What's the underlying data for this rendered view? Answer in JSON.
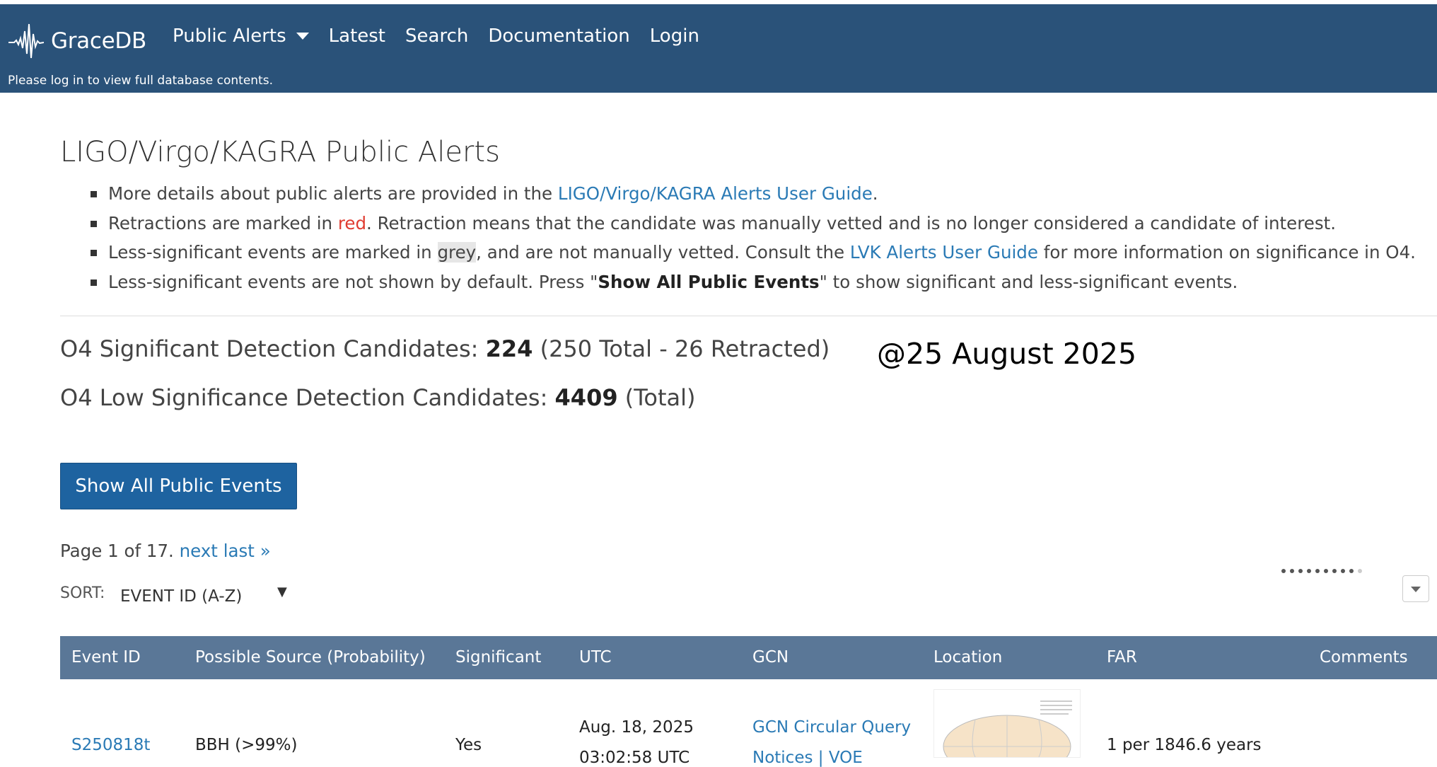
{
  "nav": {
    "brand": "GraceDB",
    "links": [
      "Public Alerts",
      "Latest",
      "Search",
      "Documentation",
      "Login"
    ],
    "login_message": "Please log in to view full database contents."
  },
  "main": {
    "title": "LIGO/Virgo/KAGRA Public Alerts",
    "notes": {
      "n1_pre": "More details about public alerts are provided in the ",
      "n1_link": "LIGO/Virgo/KAGRA Alerts User Guide",
      "n1_post": ".",
      "n2_pre": "Retractions are marked in ",
      "n2_red": "red",
      "n2_post": ". Retraction means that the candidate was manually vetted and is no longer considered a candidate of interest.",
      "n3_pre": "Less-significant events are marked in ",
      "n3_grey": "grey",
      "n3_mid": ", and are not manually vetted. Consult the ",
      "n3_link": "LVK Alerts User Guide",
      "n3_post": " for more information on significance in O4.",
      "n4_pre": "Less-significant events are not shown by default. Press \"",
      "n4_bold": "Show All Public Events",
      "n4_post": "\" to show significant and less-significant events."
    },
    "significant": {
      "label": "O4 Significant Detection Candidates: ",
      "count": "224",
      "detail": " (250 Total - 26 Retracted)"
    },
    "low_significance": {
      "label": "O4 Low Significance Detection Candidates: ",
      "count": "4409",
      "detail": " (Total)"
    },
    "date_stamp": "@25 August 2025",
    "show_all_button": "Show All Public Events",
    "pagination": {
      "text": "Page 1 of 17. ",
      "next": "next",
      "last": "last »"
    },
    "sort": {
      "label": "SORT:",
      "value": "EVENT ID (A-Z)",
      "arrow": "▼"
    }
  },
  "table": {
    "headers": {
      "event_id": "Event ID",
      "source": "Possible Source (Probability)",
      "significant": "Significant",
      "utc": "UTC",
      "gcn": "GCN",
      "location": "Location",
      "far": "FAR",
      "comments": "Comments"
    },
    "rows": [
      {
        "event_id": "S250818t",
        "source": "BBH (>99%)",
        "significant": "Yes",
        "utc_date": "Aug. 18, 2025",
        "utc_time": "03:02:58 UTC",
        "gcn_link": "GCN Circular Query",
        "gcn_notices": "Notices | VOE",
        "far": "1 per 1846.6 years"
      }
    ]
  },
  "colors": {
    "navbar": "#2a5279",
    "table_header": "#5a7797",
    "button": "#1e63a0",
    "link": "#2a7ab5",
    "retraction": "#e03c31"
  }
}
